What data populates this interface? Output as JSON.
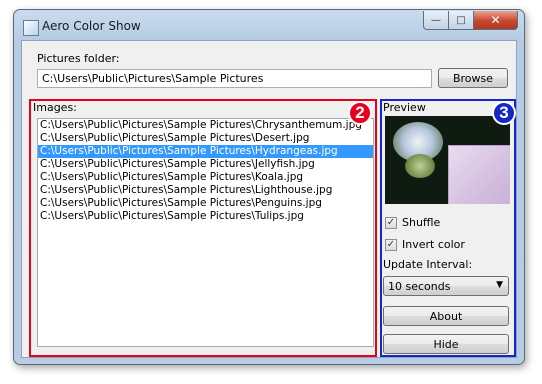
{
  "window": {
    "title": "Aero Color Show",
    "minimize_glyph": "—",
    "maximize_glyph": "□",
    "close_glyph": "✕"
  },
  "folder": {
    "label": "Pictures folder:",
    "value": "C:\\Users\\Public\\Pictures\\Sample Pictures",
    "browse_label": "Browse"
  },
  "images": {
    "label": "Images:",
    "badge": "2",
    "items": [
      "C:\\Users\\Public\\Pictures\\Sample Pictures\\Chrysanthemum.jpg",
      "C:\\Users\\Public\\Pictures\\Sample Pictures\\Desert.jpg",
      "C:\\Users\\Public\\Pictures\\Sample Pictures\\Hydrangeas.jpg",
      "C:\\Users\\Public\\Pictures\\Sample Pictures\\Jellyfish.jpg",
      "C:\\Users\\Public\\Pictures\\Sample Pictures\\Koala.jpg",
      "C:\\Users\\Public\\Pictures\\Sample Pictures\\Lighthouse.jpg",
      "C:\\Users\\Public\\Pictures\\Sample Pictures\\Penguins.jpg",
      "C:\\Users\\Public\\Pictures\\Sample Pictures\\Tulips.jpg"
    ],
    "selected_index": 2
  },
  "preview": {
    "label": "Preview",
    "badge": "3",
    "shuffle_label": "Shuffle",
    "shuffle_checked": true,
    "invert_label": "Invert color",
    "invert_checked": true,
    "interval_label": "Update Interval:",
    "interval_value": "10 seconds",
    "about_label": "About",
    "hide_label": "Hide"
  },
  "colors": {
    "images_group_border": "#e8001c",
    "preview_group_border": "#1428c8",
    "selection": "#3399ff"
  }
}
